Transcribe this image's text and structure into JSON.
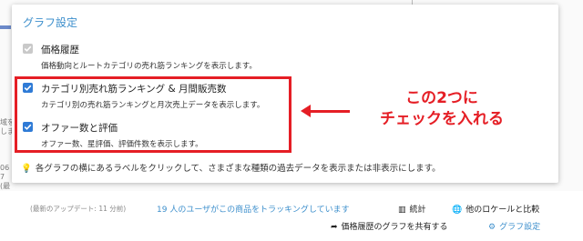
{
  "popup": {
    "title": "グラフ設定",
    "options": [
      {
        "label": "価格履歴",
        "desc": "価格動向とルートカテゴリの売れ筋ランキングを表示します。",
        "checked": true,
        "disabled": true
      },
      {
        "label": "カテゴリ別売れ筋ランキング & 月間販売数",
        "desc": "カテゴリ別の売れ筋ランキングと月次売上データを表示します。",
        "checked": true,
        "disabled": false
      },
      {
        "label": "オファー数と評価",
        "desc": "オファー数、星評価、評価件数を表示します。",
        "checked": true,
        "disabled": false
      }
    ],
    "hint": "各グラフの横にあるラベルをクリックして、さまざまな種類の過去データを表示または非表示にします。"
  },
  "annotation": {
    "line1": "この2つに",
    "line2": "チェックを入れる",
    "color": "#e51e25"
  },
  "footer": {
    "updated": "(最新のアップデート: 11 分前)",
    "tracking": "19 人のユーザがこの商品をトラッキングしています",
    "stats": "統計",
    "locale": "他のロケールと比較",
    "share": "価格履歴のグラフを共有する",
    "settings": "グラフ設定"
  },
  "side_text": [
    "域を",
    "しま",
    "06",
    "7",
    "(最"
  ],
  "colors": {
    "accent": "#3d8fcc",
    "checkbox": "#2f7bd6",
    "highlight": "#e51e25"
  }
}
